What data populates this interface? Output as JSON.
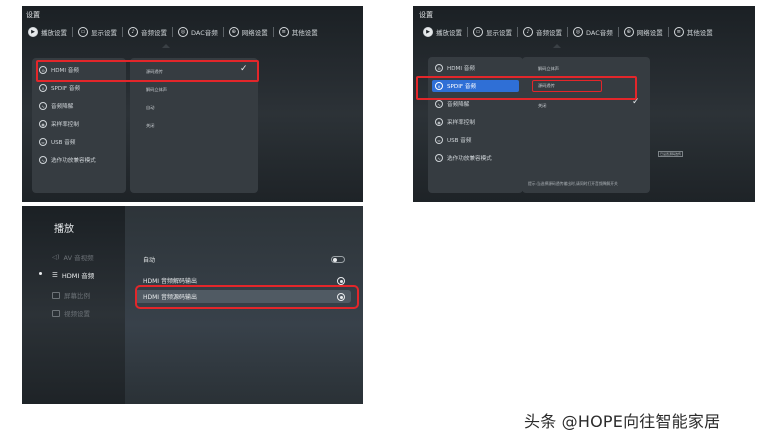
{
  "screens": {
    "hdmi": {
      "title": "设置",
      "tabs": [
        {
          "icon": "play-circle-icon",
          "glyph": "▶",
          "label": "播放设置"
        },
        {
          "icon": "display-icon",
          "glyph": "▭",
          "label": "显示设置"
        },
        {
          "icon": "audio-icon",
          "glyph": "♪",
          "label": "音频设置"
        },
        {
          "icon": "dac-icon",
          "glyph": "◎",
          "label": "DAC音频"
        },
        {
          "icon": "globe-icon",
          "glyph": "⊕",
          "label": "网络设置"
        },
        {
          "icon": "menu-icon",
          "glyph": "≡",
          "label": "其他设置"
        }
      ],
      "menu": [
        {
          "icon": "hdmi-icon",
          "glyph": "⊖",
          "label": "HDMI 音频",
          "active": false
        },
        {
          "icon": "spdif-icon",
          "glyph": "∩",
          "label": "SPDIF 音频",
          "active": false
        },
        {
          "icon": "downmix-icon",
          "glyph": "∿",
          "label": "音频降解",
          "active": false
        },
        {
          "icon": "samplerate-icon",
          "glyph": "◉",
          "label": "采样率控制",
          "active": false
        },
        {
          "icon": "usb-icon",
          "glyph": "⇔",
          "label": "USB 音频",
          "active": false
        },
        {
          "icon": "compat-icon",
          "glyph": "∿",
          "label": "选作功放兼容模式",
          "active": false
        }
      ],
      "options": [
        "源码透传",
        "解码立体声",
        "自动",
        "关闭"
      ],
      "check": "✓"
    },
    "spdif": {
      "title": "设置",
      "tabs": [
        {
          "icon": "play-circle-icon",
          "glyph": "▶",
          "label": "播放设置"
        },
        {
          "icon": "display-icon",
          "glyph": "▭",
          "label": "显示设置"
        },
        {
          "icon": "audio-icon",
          "glyph": "♪",
          "label": "音频设置"
        },
        {
          "icon": "dac-icon",
          "glyph": "◎",
          "label": "DAC音频"
        },
        {
          "icon": "globe-icon",
          "glyph": "⊕",
          "label": "网络设置"
        },
        {
          "icon": "menu-icon",
          "glyph": "≡",
          "label": "其他设置"
        }
      ],
      "menu": [
        {
          "icon": "hdmi-icon",
          "glyph": "⊖",
          "label": "HDMI 音频",
          "active": false
        },
        {
          "icon": "spdif-icon",
          "glyph": "∩",
          "label": "SPDIF 音频",
          "active": true
        },
        {
          "icon": "downmix-icon",
          "glyph": "∿",
          "label": "音频降解",
          "active": false
        },
        {
          "icon": "samplerate-icon",
          "glyph": "◉",
          "label": "采样率控制",
          "active": false
        },
        {
          "icon": "usb-icon",
          "glyph": "⇔",
          "label": "USB 音频",
          "active": false
        },
        {
          "icon": "compat-icon",
          "glyph": "∿",
          "label": "选作功放兼容模式",
          "active": false
        }
      ],
      "options": [
        "解码立体声",
        "源码透传",
        "关闭"
      ],
      "check": "✓",
      "hint": "提示:当选择源码透传输出时,请同时打开音频降解开关",
      "badge": "已设置源码透传"
    },
    "playback": {
      "title": "播放",
      "sidebar": [
        {
          "icon": "av-icon",
          "glyph": "◁)",
          "label": "AV 音视频"
        },
        {
          "icon": "hdmi-icon",
          "glyph": "☰",
          "label": "HDMI 音频"
        },
        {
          "icon": "screen-icon",
          "glyph": "▭",
          "label": "屏幕比例"
        },
        {
          "icon": "window-icon",
          "glyph": "▭",
          "label": "视频设置"
        }
      ],
      "rows": [
        {
          "label": "自动",
          "control": "toggle",
          "on": false
        },
        {
          "label": "HDMI 音频解码输出",
          "control": "radio",
          "on": true
        },
        {
          "label": "HDMI 音频源码输出",
          "control": "radio",
          "on": true
        }
      ]
    }
  },
  "watermark": "头条 @HOPE向往智能家居",
  "colors": {
    "highlight_box": "#e3262a",
    "active_item": "#2f6fd6"
  }
}
